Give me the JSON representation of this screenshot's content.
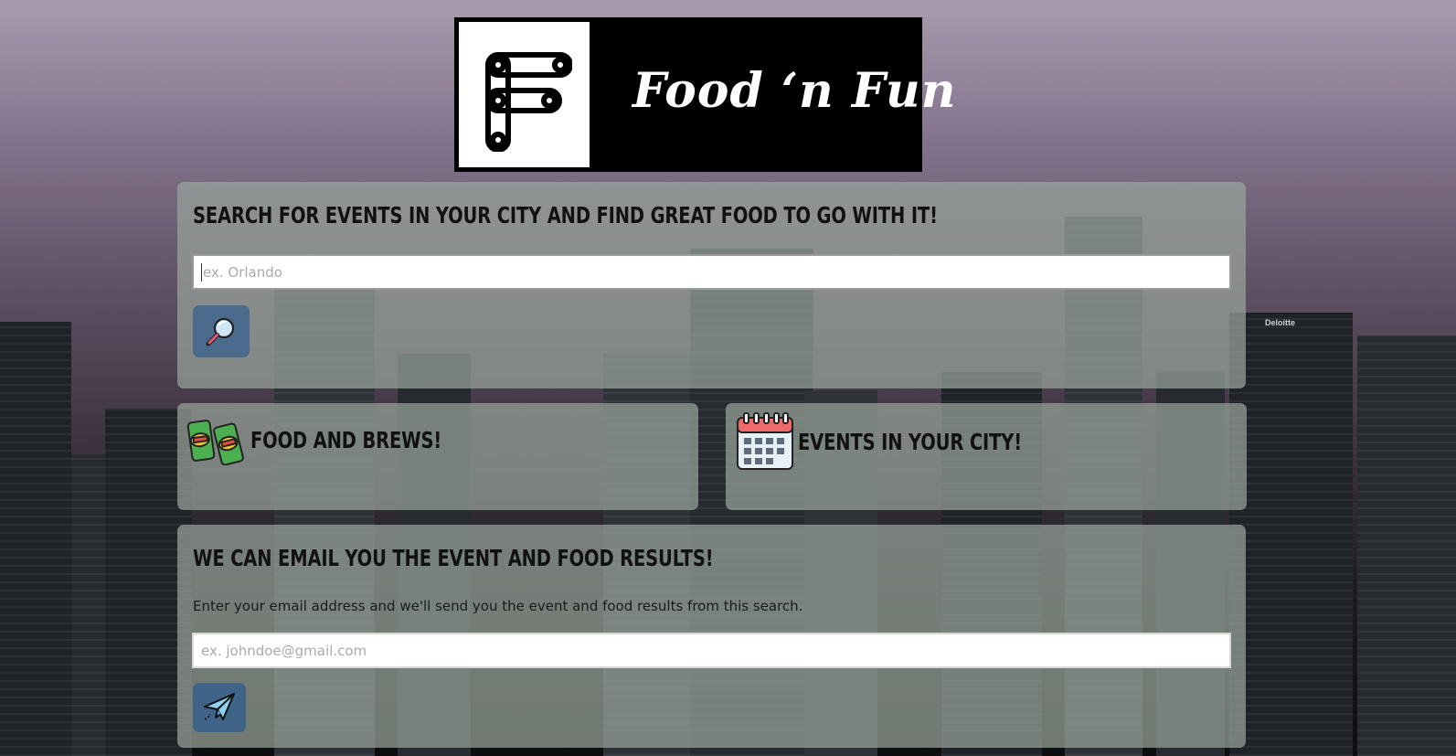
{
  "brand": {
    "name": "Food ‘n Fun"
  },
  "search_panel": {
    "heading": "Search for events in your city and find great food to go with it!",
    "input_placeholder": "ex. Orlando",
    "search_icon": "magnifier-icon"
  },
  "food_panel": {
    "title": "Food and Brews!",
    "icon": "drink-cans-icon"
  },
  "events_panel": {
    "title": "Events in your City!",
    "icon": "calendar-icon"
  },
  "email_panel": {
    "heading": "We can email you the event and food results!",
    "description": "Enter your email address and we'll send you the event and food results from this search.",
    "input_placeholder": "ex. johndoe@gmail.com",
    "send_icon": "paper-plane-icon"
  },
  "colors": {
    "panel": "#98a49a",
    "button": "#4a6b8c",
    "logo_bg": "#000000"
  }
}
